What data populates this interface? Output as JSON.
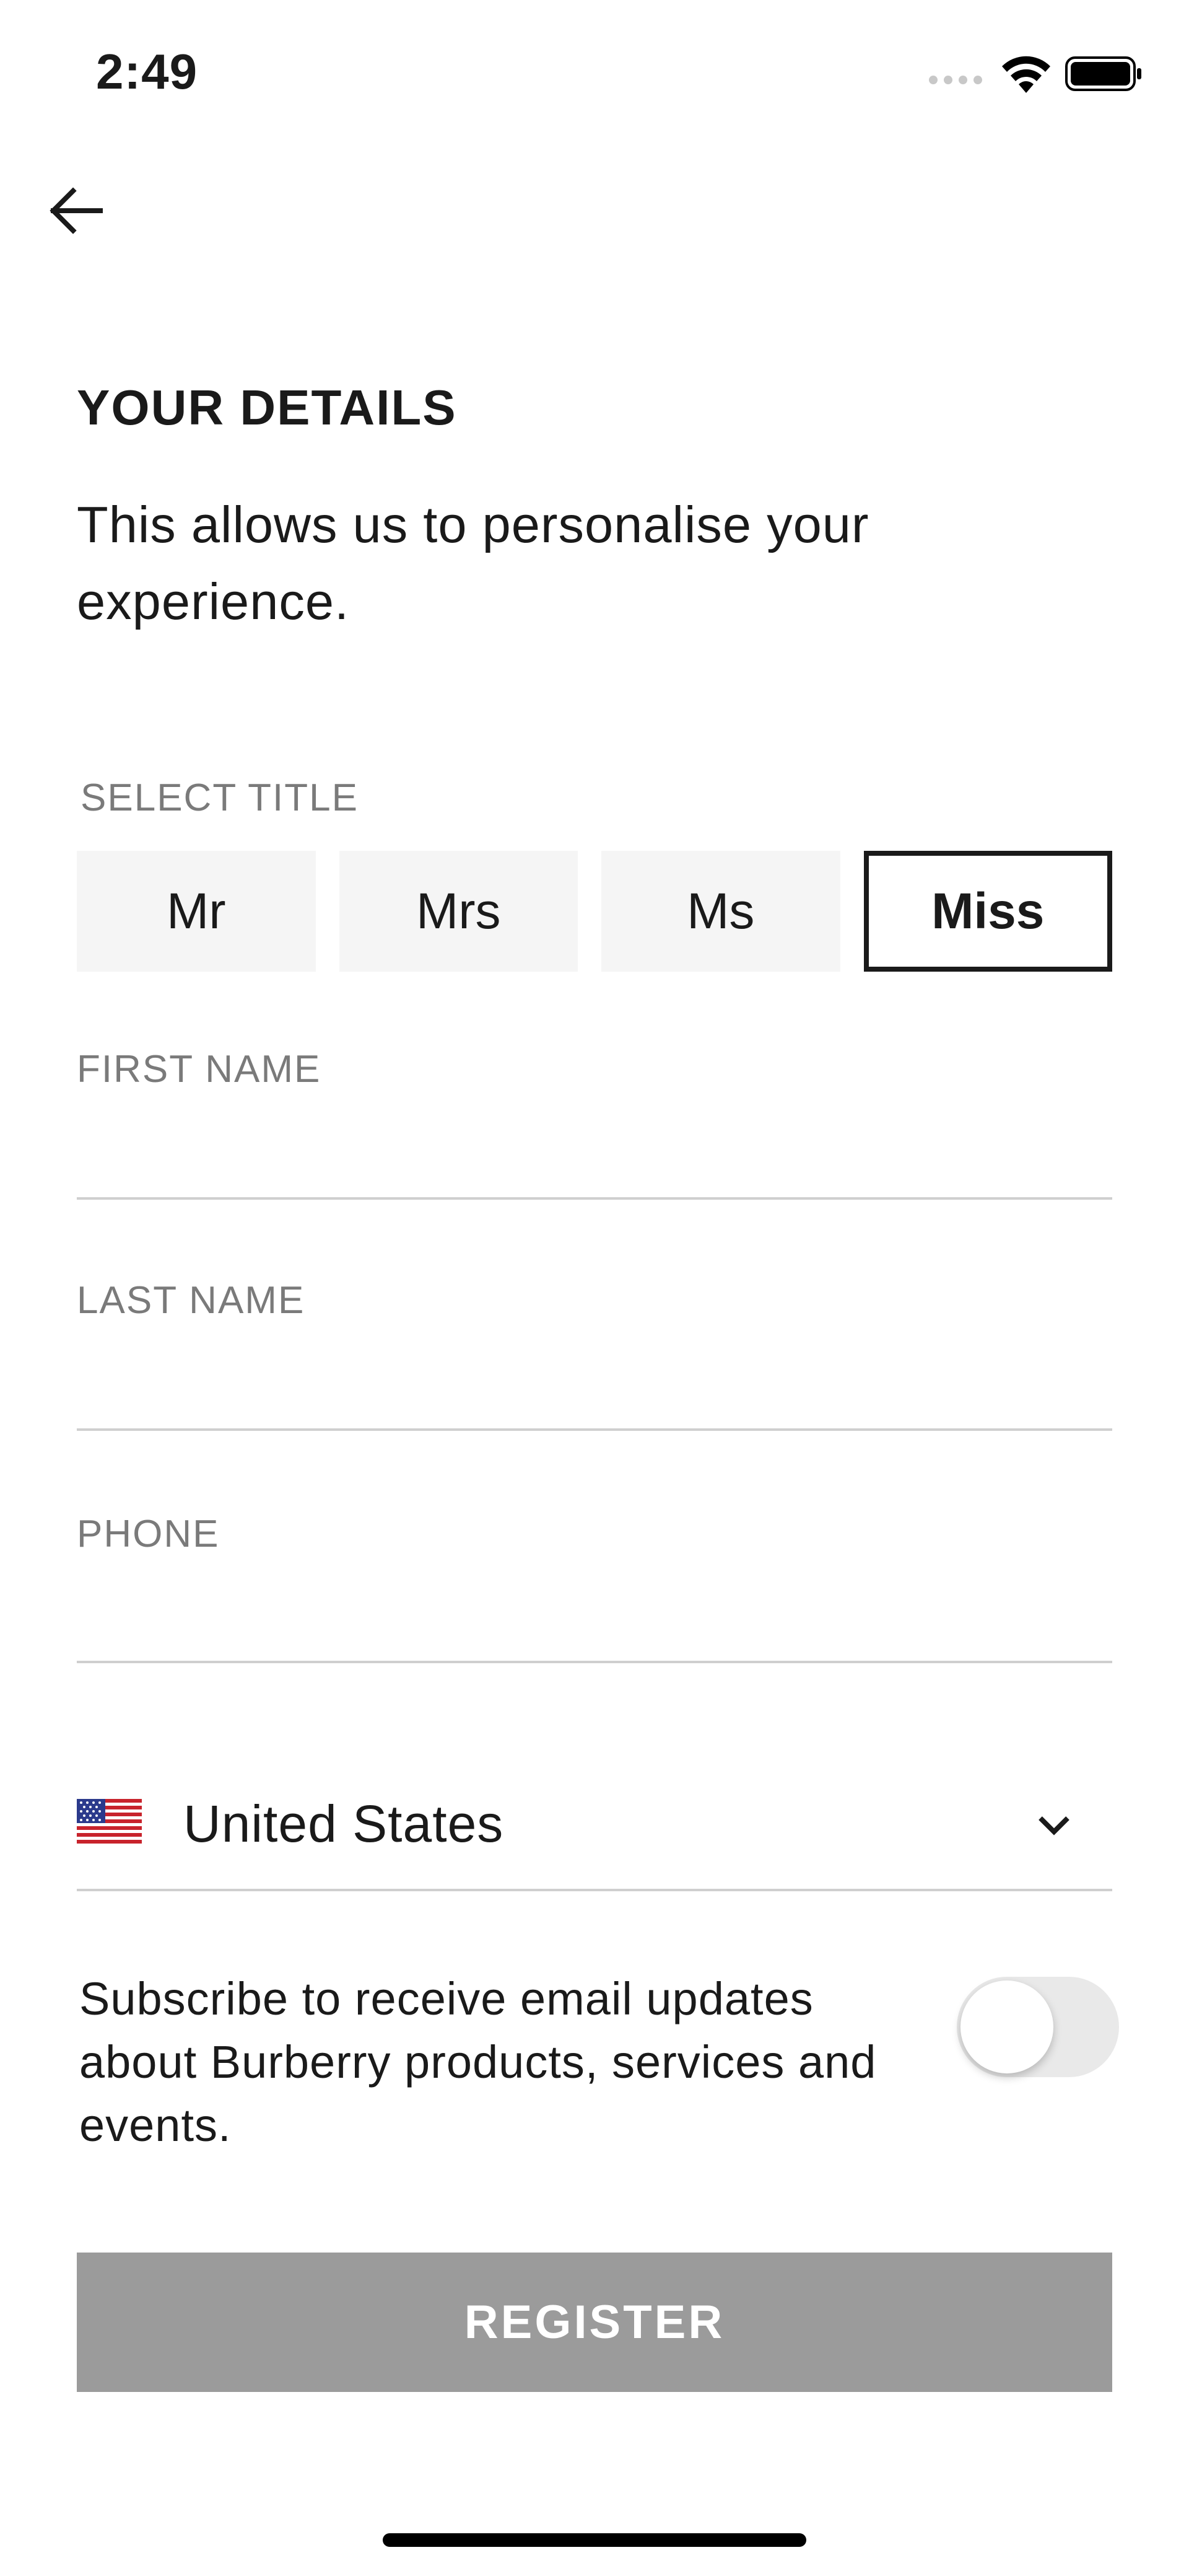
{
  "status_bar": {
    "time": "2:49"
  },
  "header": {
    "back_icon": "arrow-left-icon"
  },
  "page": {
    "title": "YOUR DETAILS",
    "subtitle": "This allows us to personalise your experience."
  },
  "form": {
    "select_title_label": "SELECT TITLE",
    "title_options": [
      "Mr",
      "Mrs",
      "Ms",
      "Miss"
    ],
    "selected_title": "Miss",
    "first_name": {
      "label": "FIRST NAME",
      "value": ""
    },
    "last_name": {
      "label": "LAST NAME",
      "value": ""
    },
    "phone": {
      "label": "PHONE",
      "value": ""
    },
    "country": {
      "flag_icon": "us-flag-icon",
      "value": "United States"
    },
    "subscribe": {
      "text": "Subscribe to receive email updates about Burberry products, services and events.",
      "enabled": false
    },
    "register_label": "REGISTER"
  },
  "colors": {
    "text": "#1a1a1a",
    "label": "#7a7a7a",
    "title_button_bg": "#f5f5f5",
    "register_disabled_bg": "#9b9b9b",
    "toggle_off_bg": "#e9e9e9"
  }
}
